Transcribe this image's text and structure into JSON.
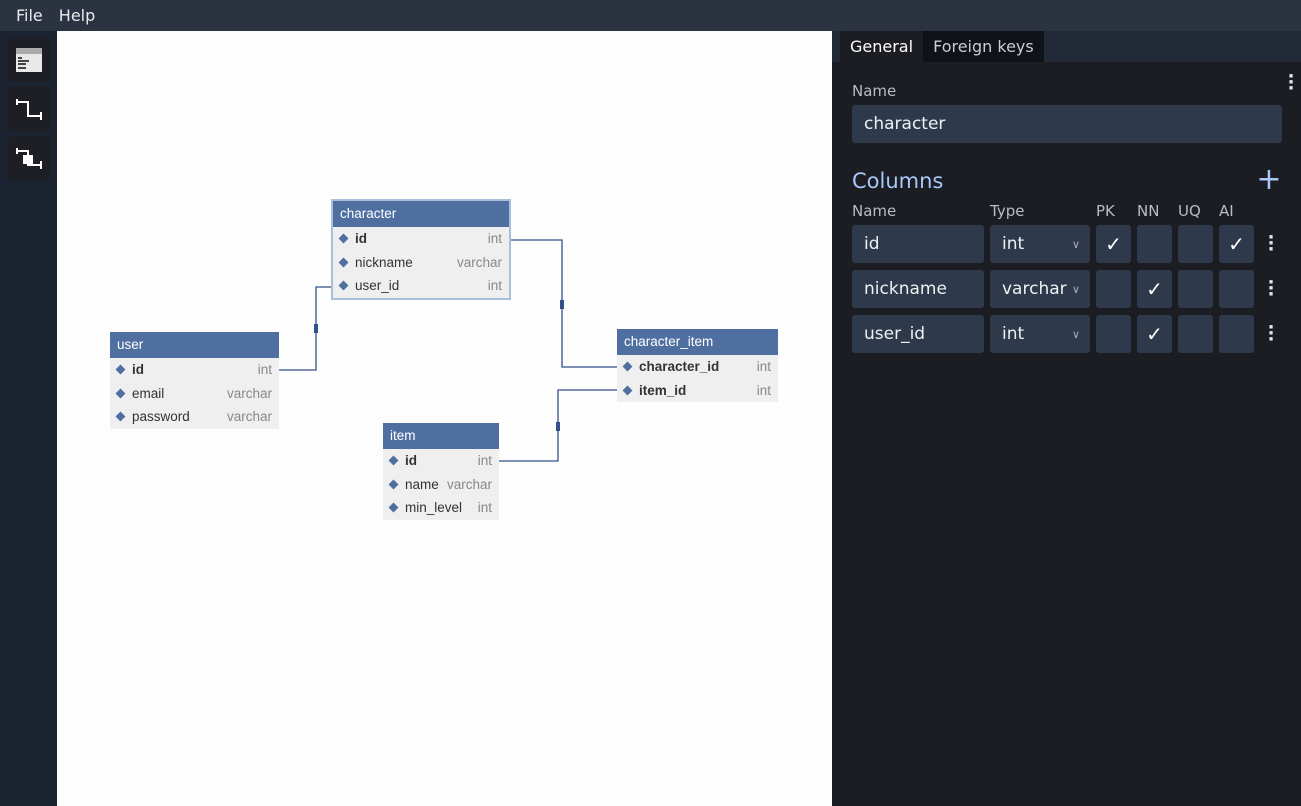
{
  "menu": {
    "file": "File",
    "help": "Help"
  },
  "sidebar": {
    "items": [
      "table-view-icon",
      "relation-icon",
      "relation-with-entity-icon"
    ]
  },
  "tables": {
    "character": {
      "name": "character",
      "rows": [
        {
          "name": "id",
          "type": "int",
          "bold": true
        },
        {
          "name": "nickname",
          "type": "varchar"
        },
        {
          "name": "user_id",
          "type": "int"
        }
      ]
    },
    "user": {
      "name": "user",
      "rows": [
        {
          "name": "id",
          "type": "int",
          "bold": true
        },
        {
          "name": "email",
          "type": "varchar"
        },
        {
          "name": "password",
          "type": "varchar"
        }
      ]
    },
    "item": {
      "name": "item",
      "rows": [
        {
          "name": "id",
          "type": "int",
          "bold": true
        },
        {
          "name": "name",
          "type": "varchar"
        },
        {
          "name": "min_level",
          "type": "int"
        }
      ]
    },
    "character_item": {
      "name": "character_item",
      "rows": [
        {
          "name": "character_id",
          "type": "int",
          "bold": true
        },
        {
          "name": "item_id",
          "type": "int",
          "bold": true
        }
      ]
    }
  },
  "panel": {
    "tabs": [
      "General",
      "Foreign keys"
    ],
    "name_label": "Name",
    "name_value": "character",
    "columns_title": "Columns",
    "headers": {
      "name": "Name",
      "type": "Type",
      "pk": "PK",
      "nn": "NN",
      "uq": "UQ",
      "ai": "AI"
    },
    "columns": [
      {
        "name": "id",
        "type": "int",
        "pk": true,
        "nn": false,
        "uq": false,
        "ai": true
      },
      {
        "name": "nickname",
        "type": "varchar",
        "pk": false,
        "nn": true,
        "uq": false,
        "ai": false
      },
      {
        "name": "user_id",
        "type": "int",
        "pk": false,
        "nn": true,
        "uq": false,
        "ai": false
      }
    ],
    "check_glyph": "✓",
    "accent": "#a8c7fa"
  }
}
